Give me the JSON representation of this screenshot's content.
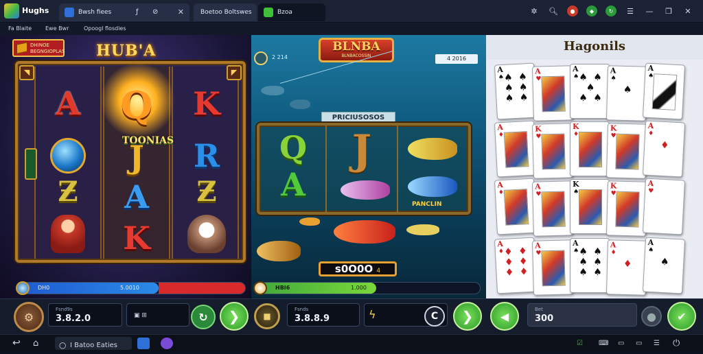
{
  "app": {
    "title": "Hughs"
  },
  "tabs": [
    {
      "label": "Bwsh fiees",
      "active": false
    },
    {
      "label": "Boetoo Boltswes",
      "active": false
    },
    {
      "label": "Bzoa",
      "active": true
    }
  ],
  "address_bar": {
    "item1": "Fa Blaite",
    "item2": "Ewe Bwr",
    "item3": "Opoogl flosdies"
  },
  "slot_panel": {
    "title": "HUB'A",
    "badge": "DHINOE BEGNGIOPLAS",
    "center_text": "TOONIAS",
    "balance_bar": {
      "label": "DH0",
      "value": "5.0010",
      "fill": 0.62
    },
    "control": {
      "caption": "Fsnd9s",
      "value": "3.8.2.0"
    }
  },
  "fish_panel": {
    "title": "BLNBA",
    "subtitle": "BLNBACOSSIN",
    "left_label": "2 214",
    "right_label": "4 2016",
    "inner_title": "PRICIUSOSOS",
    "inner_label": "PANCLIN",
    "win_box": "s0O0O",
    "win_box_tail": "4",
    "progress_bar": {
      "label": "HBI6",
      "value": "1.000",
      "fill": 0.54
    },
    "control": {
      "caption": "Fsnds",
      "value": "3.8.8.9"
    }
  },
  "card_panel": {
    "title": "Hagonils",
    "control": {
      "caption": "Bet",
      "value": "300"
    },
    "rows": [
      [
        {
          "rank": "A",
          "suit": "♠",
          "color": "blk",
          "type": "pips",
          "pips": "♠ ♠\n♠ ♠\n♠ ♠"
        },
        {
          "rank": "A",
          "suit": "♥",
          "color": "red",
          "type": "face"
        },
        {
          "rank": "A",
          "suit": "♠",
          "color": "blk",
          "type": "pips",
          "pips": "♠ ♠\n♠\n♠ ♠"
        },
        {
          "rank": "A",
          "suit": "♠",
          "color": "blk",
          "type": "pips",
          "pips": "\n♠\n"
        },
        {
          "rank": "A",
          "suit": "♠",
          "color": "blk",
          "type": "art"
        }
      ],
      [
        {
          "rank": "A",
          "suit": "♦",
          "color": "red",
          "type": "face"
        },
        {
          "rank": "K",
          "suit": "♥",
          "color": "red",
          "type": "face"
        },
        {
          "rank": "K",
          "suit": "♦",
          "color": "red",
          "type": "face"
        },
        {
          "rank": "K",
          "suit": "♥",
          "color": "red",
          "type": "face"
        },
        {
          "rank": "A",
          "suit": "♦",
          "color": "red",
          "type": "pips",
          "pips": "\n♦\n"
        }
      ],
      [
        {
          "rank": "A",
          "suit": "♦",
          "color": "red",
          "type": "face"
        },
        {
          "rank": "A",
          "suit": "♥",
          "color": "red",
          "type": "face"
        },
        {
          "rank": "K",
          "suit": "♠",
          "color": "blk",
          "type": "face"
        },
        {
          "rank": "K",
          "suit": "♥",
          "color": "red",
          "type": "face"
        },
        {
          "rank": "A",
          "suit": "♥",
          "color": "red",
          "type": "pips",
          "pips": ""
        }
      ],
      [
        {
          "rank": "A",
          "suit": "♦",
          "color": "red",
          "type": "pips",
          "pips": "♦ ♦\n♦ ♦\n♦ ♦"
        },
        {
          "rank": "A",
          "suit": "♥",
          "color": "red",
          "type": "face"
        },
        {
          "rank": "A",
          "suit": "♠",
          "color": "blk",
          "type": "pips",
          "pips": "♠ ♠\n♠ ♠\n♠ ♠"
        },
        {
          "rank": "A",
          "suit": "♦",
          "color": "red",
          "type": "pips",
          "pips": "\n♦\n"
        },
        {
          "rank": "A",
          "suit": "♠",
          "color": "blk",
          "type": "pips",
          "pips": "\n♠\n"
        }
      ]
    ]
  },
  "taskbar": {
    "search_label": "I Batoo Eaties"
  },
  "colors": {
    "accent_green": "#3fbf3a",
    "gold": "#e0a830",
    "bar_red": "#d82a2a",
    "bar_blue": "#2a7ae0"
  }
}
